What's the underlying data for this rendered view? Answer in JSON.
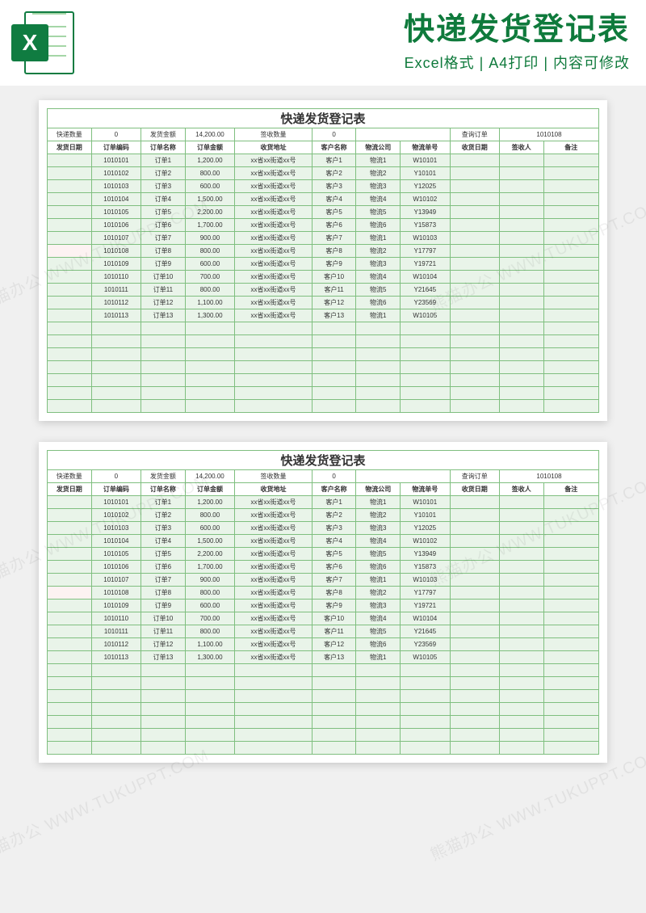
{
  "banner": {
    "title": "快递发货登记表",
    "subtitle": "Excel格式 | A4打印 | 内容可修改"
  },
  "watermark": "熊猫办公 WWW.TUKUPPT.COM",
  "doc": {
    "title": "快递发货登记表",
    "summary": {
      "ship_qty_label": "快递数量",
      "ship_qty_value": "0",
      "ship_amt_label": "发货金额",
      "ship_amt_value": "14,200.00",
      "sign_qty_label": "签收数量",
      "sign_qty_value": "0",
      "lookup_label": "查询订单",
      "lookup_value": "1010108"
    },
    "columns": [
      "发货日期",
      "订单编码",
      "订单名称",
      "订单金额",
      "收货地址",
      "客户名称",
      "物流公司",
      "物流单号",
      "收货日期",
      "签收人",
      "备注"
    ],
    "rows": [
      {
        "code": "1010101",
        "name": "订单1",
        "amt": "1,200.00",
        "addr": "xx省xx街道xx号",
        "cust": "客户1",
        "logi": "物流1",
        "lognum": "W10101"
      },
      {
        "code": "1010102",
        "name": "订单2",
        "amt": "800.00",
        "addr": "xx省xx街道xx号",
        "cust": "客户2",
        "logi": "物流2",
        "lognum": "Y10101"
      },
      {
        "code": "1010103",
        "name": "订单3",
        "amt": "600.00",
        "addr": "xx省xx街道xx号",
        "cust": "客户3",
        "logi": "物流3",
        "lognum": "Y12025"
      },
      {
        "code": "1010104",
        "name": "订单4",
        "amt": "1,500.00",
        "addr": "xx省xx街道xx号",
        "cust": "客户4",
        "logi": "物流4",
        "lognum": "W10102"
      },
      {
        "code": "1010105",
        "name": "订单5",
        "amt": "2,200.00",
        "addr": "xx省xx街道xx号",
        "cust": "客户5",
        "logi": "物流5",
        "lognum": "Y13949"
      },
      {
        "code": "1010106",
        "name": "订单6",
        "amt": "1,700.00",
        "addr": "xx省xx街道xx号",
        "cust": "客户6",
        "logi": "物流6",
        "lognum": "Y15873"
      },
      {
        "code": "1010107",
        "name": "订单7",
        "amt": "900.00",
        "addr": "xx省xx街道xx号",
        "cust": "客户7",
        "logi": "物流1",
        "lognum": "W10103"
      },
      {
        "code": "1010108",
        "name": "订单8",
        "amt": "800.00",
        "addr": "xx省xx街道xx号",
        "cust": "客户8",
        "logi": "物流2",
        "lognum": "Y17797",
        "highlight": true
      },
      {
        "code": "1010109",
        "name": "订单9",
        "amt": "600.00",
        "addr": "xx省xx街道xx号",
        "cust": "客户9",
        "logi": "物流3",
        "lognum": "Y19721"
      },
      {
        "code": "1010110",
        "name": "订单10",
        "amt": "700.00",
        "addr": "xx省xx街道xx号",
        "cust": "客户10",
        "logi": "物流4",
        "lognum": "W10104"
      },
      {
        "code": "1010111",
        "name": "订单11",
        "amt": "800.00",
        "addr": "xx省xx街道xx号",
        "cust": "客户11",
        "logi": "物流5",
        "lognum": "Y21645"
      },
      {
        "code": "1010112",
        "name": "订单12",
        "amt": "1,100.00",
        "addr": "xx省xx街道xx号",
        "cust": "客户12",
        "logi": "物流6",
        "lognum": "Y23569"
      },
      {
        "code": "1010113",
        "name": "订单13",
        "amt": "1,300.00",
        "addr": "xx省xx街道xx号",
        "cust": "客户13",
        "logi": "物流1",
        "lognum": "W10105"
      }
    ],
    "blank_rows": 7
  }
}
